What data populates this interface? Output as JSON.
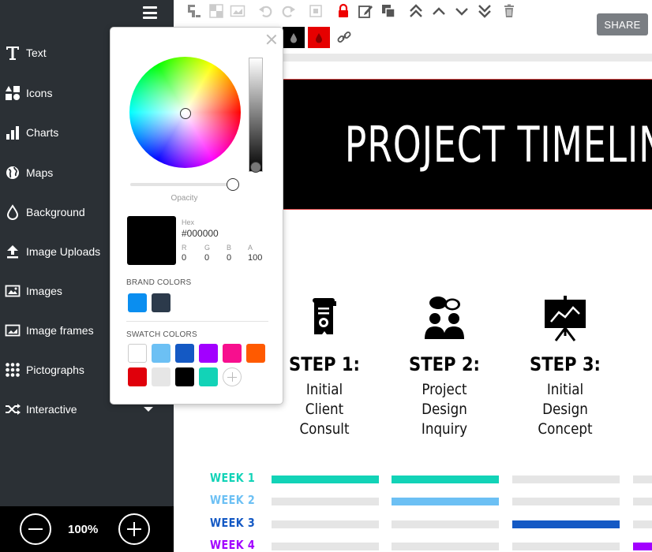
{
  "sidebar": {
    "items": [
      {
        "label": "Text",
        "icon": "text-icon"
      },
      {
        "label": "Icons",
        "icon": "icons-icon"
      },
      {
        "label": "Charts",
        "icon": "chart-icon"
      },
      {
        "label": "Maps",
        "icon": "globe-icon"
      },
      {
        "label": "Background",
        "icon": "droplet-icon"
      },
      {
        "label": "Image Uploads",
        "icon": "upload-icon"
      },
      {
        "label": "Images",
        "icon": "image-icon"
      },
      {
        "label": "Image frames",
        "icon": "frame-icon"
      },
      {
        "label": "Pictographs",
        "icon": "pictograph-icon"
      },
      {
        "label": "Interactive",
        "icon": "shuffle-icon"
      }
    ],
    "zoom": "100%"
  },
  "toolbar": {
    "share_label": "SHARE",
    "fill_colors": [
      "#000000",
      "#e60000"
    ]
  },
  "picker": {
    "opacity_label": "Opacity",
    "opacity": 1.0,
    "hex_label": "Hex",
    "hex_value": "#000000",
    "r_label": "R",
    "g_label": "G",
    "b_label": "B",
    "a_label": "A",
    "r": "0",
    "g": "0",
    "b": "0",
    "a": "100",
    "brand_title": "BRAND COLORS",
    "brand_colors": [
      "#0a8ef0",
      "#2c3a4b"
    ],
    "swatch_title": "SWATCH COLORS",
    "swatch_colors": [
      "#ffffff",
      "#6cc0f4",
      "#1459c4",
      "#a200ff",
      "#f70f8e",
      "#ff5a00",
      "#e0000b",
      "#e6e6e6",
      "#000000",
      "#12d3b7"
    ]
  },
  "canvas": {
    "banner_title": "PROJECT TIMELINE",
    "steps": [
      {
        "title": "STEP 1:",
        "line1": "Initial",
        "line2": "Client",
        "line3": "Consult"
      },
      {
        "title": "STEP 2:",
        "line1": "Project",
        "line2": "Design",
        "line3": "Inquiry"
      },
      {
        "title": "STEP 3:",
        "line1": "Initial",
        "line2": "Design",
        "line3": "Concept"
      }
    ],
    "weeks": [
      {
        "label": "WEEK 1",
        "color": "#12d3b7",
        "active": [
          0,
          1
        ]
      },
      {
        "label": "WEEK 2",
        "color": "#6cc0f4",
        "active": [
          1
        ]
      },
      {
        "label": "WEEK 3",
        "color": "#1459c4",
        "active": [
          2
        ]
      },
      {
        "label": "WEEK 4",
        "color": "#a200ff",
        "active": [
          3
        ]
      }
    ]
  }
}
